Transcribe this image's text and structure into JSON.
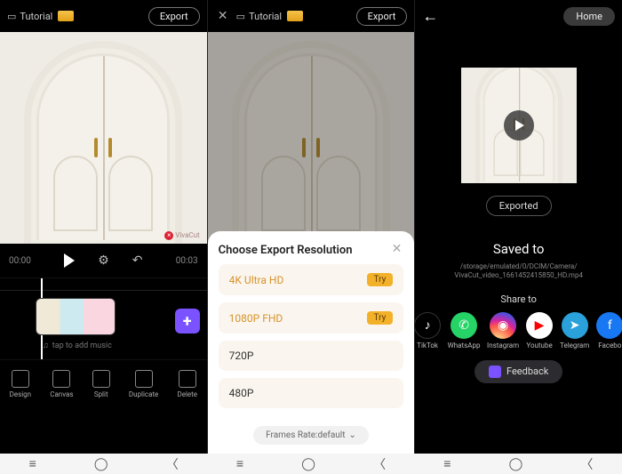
{
  "panel1": {
    "tab_label": "Tutorial",
    "export_label": "Export",
    "time_current": "00:00",
    "time_total": "00:03",
    "audio_hint": "tap to add music",
    "tools": [
      "Design",
      "Canvas",
      "Split",
      "Duplicate",
      "Delete"
    ]
  },
  "panel2": {
    "tab_label": "Tutorial",
    "export_label": "Export",
    "sheet_title": "Choose Export Resolution",
    "resolutions": [
      {
        "label": "4K Ultra HD",
        "badge": "Try",
        "gold": true
      },
      {
        "label": "1080P FHD",
        "badge": "Try",
        "gold": true
      },
      {
        "label": "720P",
        "badge": "",
        "gold": false
      },
      {
        "label": "480P",
        "badge": "",
        "gold": false
      }
    ],
    "frame_rate_label": "Frames Rate:default"
  },
  "panel3": {
    "home_label": "Home",
    "exported_label": "Exported",
    "saved_title": "Saved to",
    "saved_path_l1": "/storage/emulated/0/DCIM/Camera/",
    "saved_path_l2": "VivaCut_video_1661452415850_HD.mp4",
    "share_title": "Share to",
    "share": [
      {
        "name": "TikTok"
      },
      {
        "name": "WhatsApp"
      },
      {
        "name": "Instagram"
      },
      {
        "name": "Youtube"
      },
      {
        "name": "Telegram"
      },
      {
        "name": "Facebo"
      }
    ],
    "feedback_label": "Feedback"
  },
  "watermark": "VivaCut"
}
